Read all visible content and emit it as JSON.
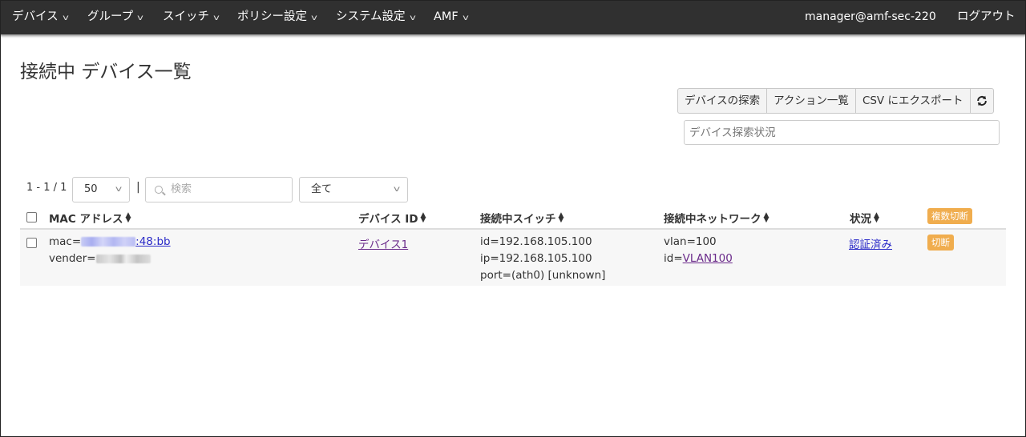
{
  "nav": {
    "items": [
      {
        "label": "デバイス"
      },
      {
        "label": "グループ"
      },
      {
        "label": "スイッチ"
      },
      {
        "label": "ポリシー設定"
      },
      {
        "label": "システム設定"
      },
      {
        "label": "AMF"
      }
    ],
    "user": "manager@amf-sec-220",
    "logout": "ログアウト"
  },
  "page": {
    "title": "接続中 デバイス一覧"
  },
  "toolbar": {
    "explore": "デバイスの探索",
    "actions": "アクション一覧",
    "csv_export": "CSV にエクスポート",
    "refresh_icon": "refresh-icon",
    "search_status_placeholder": "デバイス探索状況"
  },
  "list_controls": {
    "range": "1 - 1 / 1",
    "page_size": "50",
    "separator": "|",
    "search_placeholder": "検索",
    "filter": "全て"
  },
  "table": {
    "columns": {
      "mac": "MAC アドレス",
      "device_id": "デバイス ID",
      "switch": "接続中スイッチ",
      "network": "接続中ネットワーク",
      "status": "状況"
    },
    "bulk_disconnect": "複数切断",
    "rows": [
      {
        "mac_prefix": "mac=",
        "mac_suffix": ":48:bb",
        "vendor_prefix": "vender=",
        "device_id": "デバイス1",
        "switch_id": "id=192.168.105.100",
        "switch_ip": "ip=192.168.105.100",
        "switch_port": "port=(ath0) [unknown]",
        "vlan": "vlan=100",
        "network_id_prefix": "id=",
        "network_id": "VLAN100",
        "status": "認証済み",
        "disconnect": "切断"
      }
    ]
  },
  "colors": {
    "navbar": "#303030",
    "badge": "#f0ad4e",
    "link": "#2a2ac8",
    "visited_link": "#6a2a8a"
  }
}
